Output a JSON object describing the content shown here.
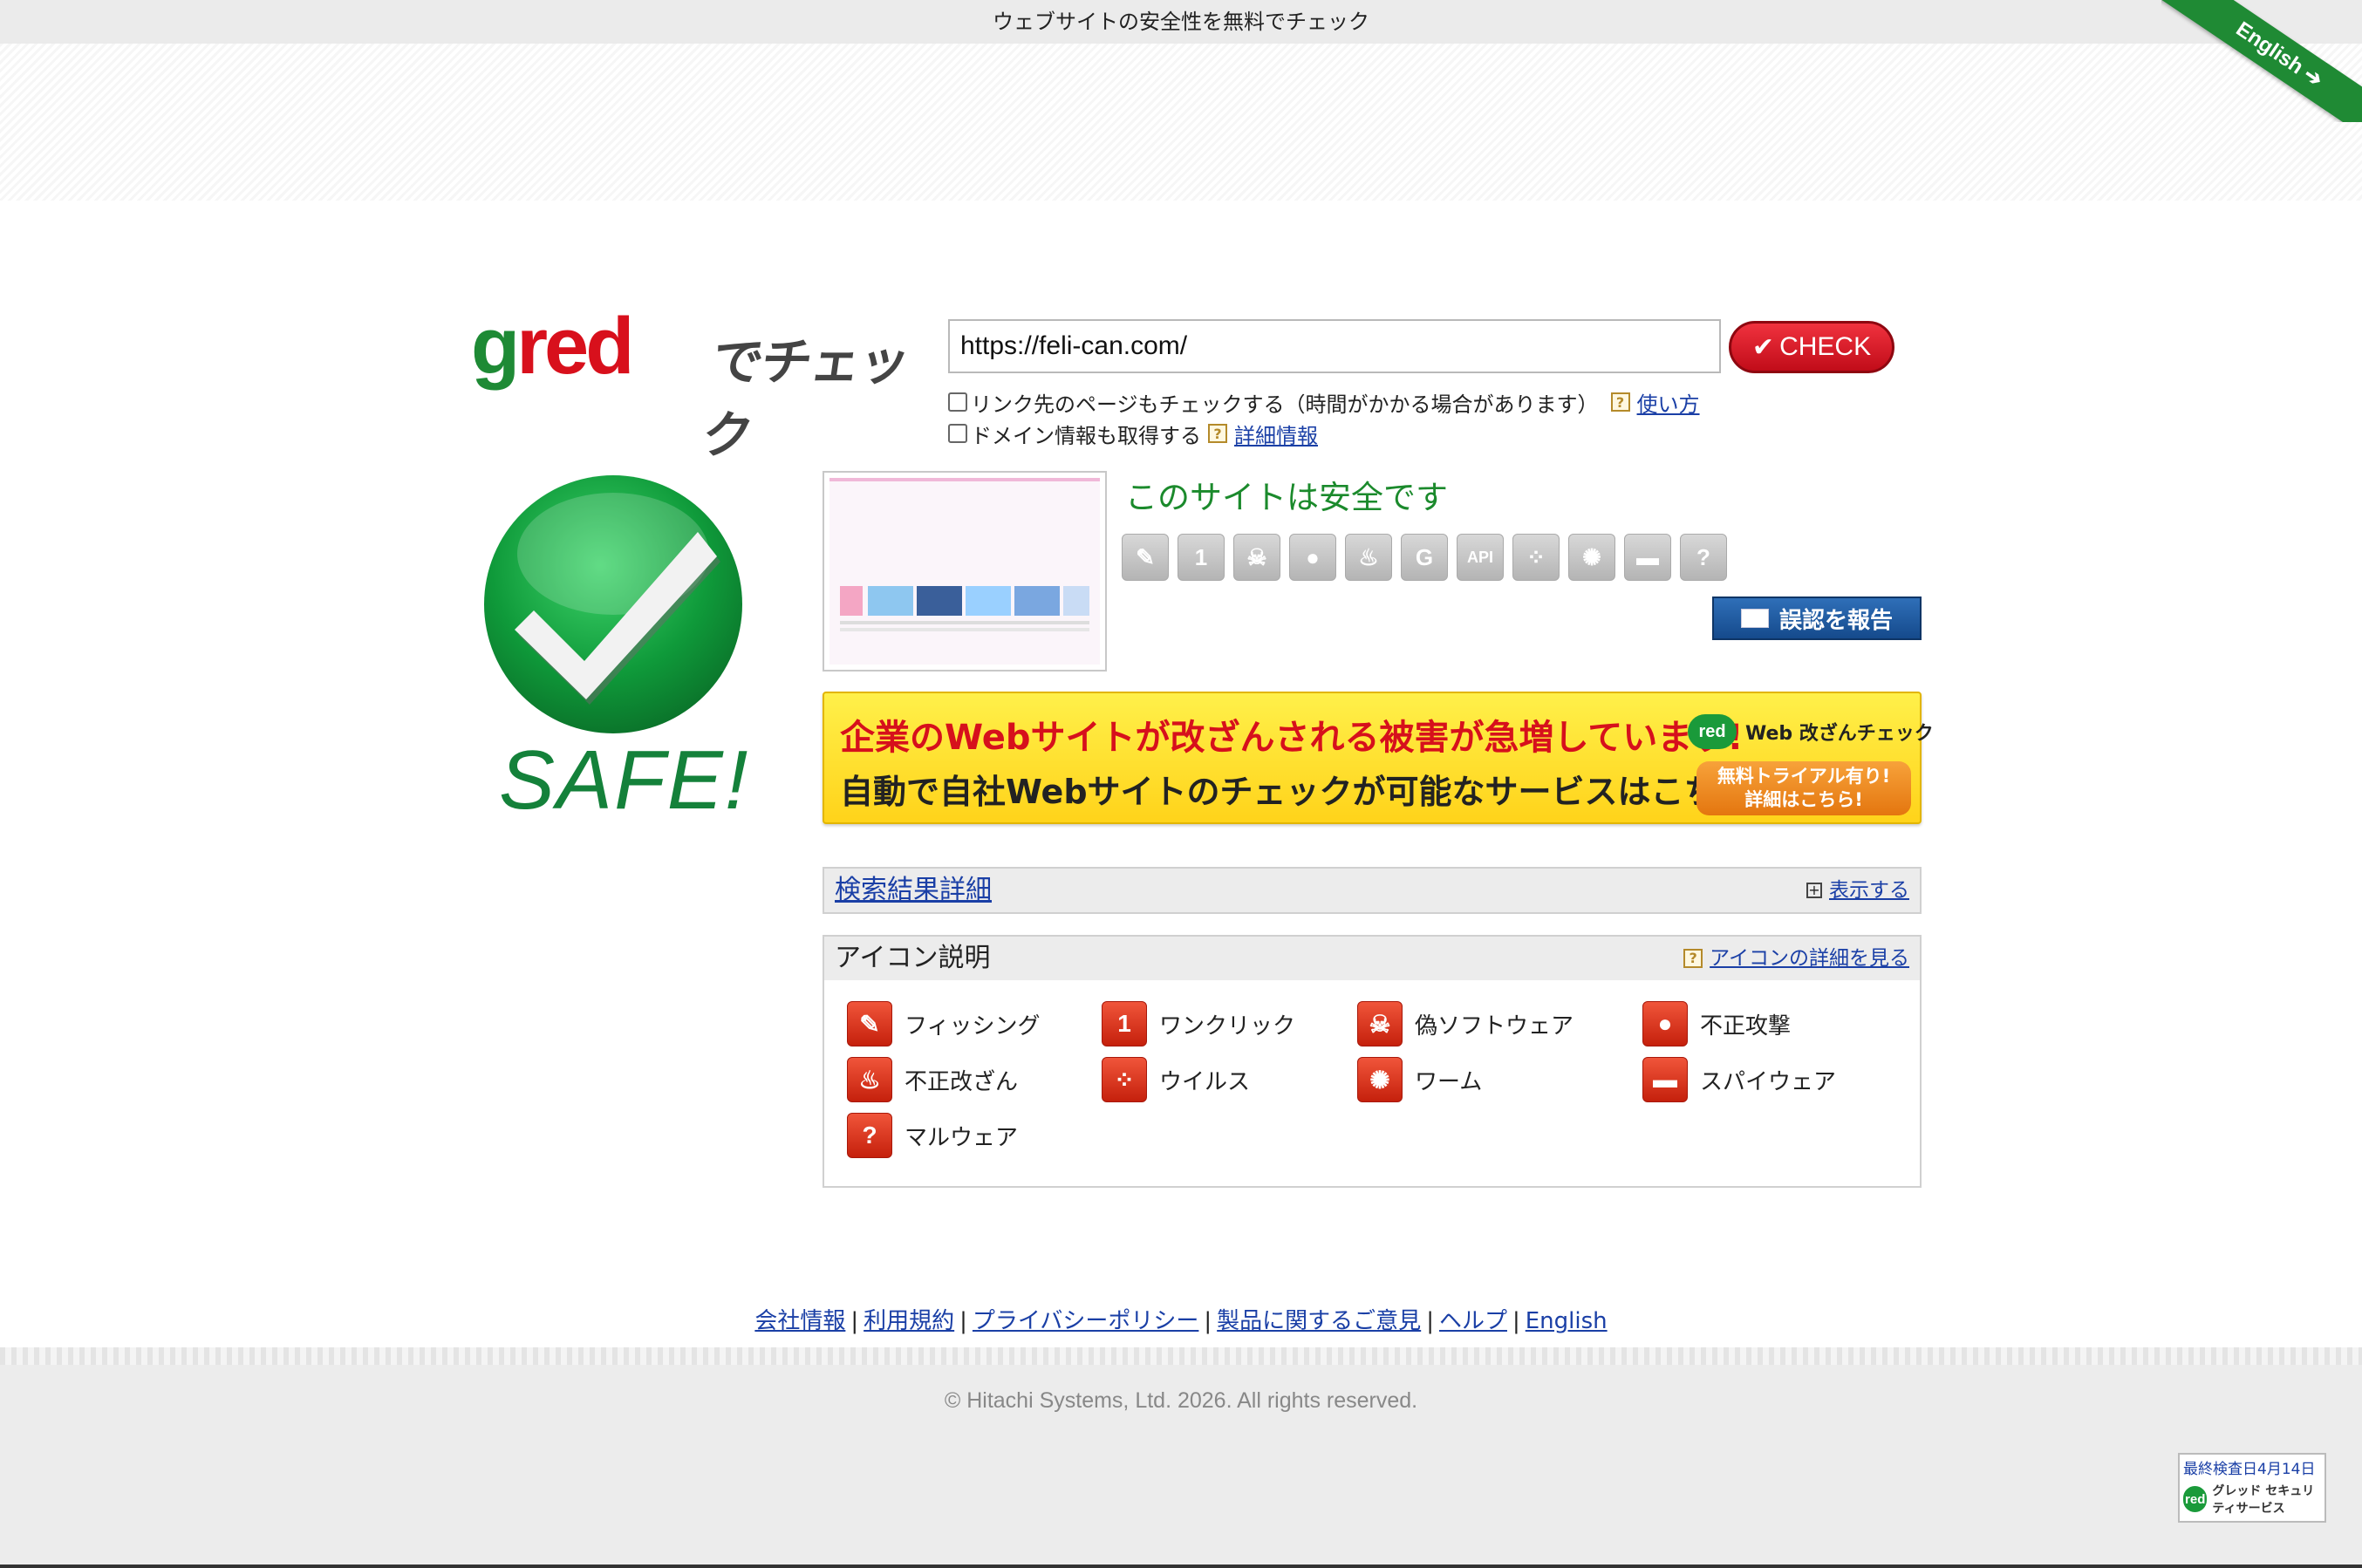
{
  "header": {
    "tagline": "ウェブサイトの安全性を無料でチェック",
    "english_ribbon": "English ➔"
  },
  "logo": {
    "letters": [
      "g",
      "r",
      "e",
      "d"
    ],
    "suffix": "でチェック"
  },
  "search": {
    "url_value": "https://feli-can.com/",
    "check_label": "CHECK"
  },
  "options": [
    {
      "label": "リンク先のページもチェックする（時間がかかる場合があります）",
      "link": "使い方",
      "checked": false
    },
    {
      "label": "ドメイン情報も取得する",
      "link": "詳細情報",
      "checked": false
    }
  ],
  "result": {
    "badge_text": "SAFE!",
    "title": "このサイトは安全です",
    "threat_icons": [
      "phishing-icon",
      "one-click-icon",
      "skull-icon",
      "bomb-icon",
      "fire-icon",
      "gred-g-icon",
      "api-icon",
      "virus-icon",
      "worm-icon",
      "spyware-gun-icon",
      "malware-question-icon"
    ],
    "threat_icon_glyphs": [
      "✎",
      "1",
      "☠",
      "●",
      "♨",
      "G",
      "API",
      "⁘",
      "✺",
      "▬",
      "?"
    ],
    "report_label": "誤認を報告"
  },
  "banner": {
    "line1": "企業のWebサイトが改ざんされる被害が急増しています!",
    "line2": "自動で自社Webサイトのチェックが可能なサービスはこちら!",
    "brand_logo": "red",
    "brand": "Web 改ざんチェック",
    "trial_line1": "無料トライアル有り!",
    "trial_line2": "詳細はこちら!"
  },
  "details_panel": {
    "title": "検索結果詳細",
    "toggle_label": "表示する"
  },
  "legend_panel": {
    "title": "アイコン説明",
    "detail_link": "アイコンの詳細を見る",
    "items": [
      {
        "label": "フィッシング",
        "icon": "phishing-icon",
        "glyph": "✎"
      },
      {
        "label": "ワンクリック",
        "icon": "one-click-icon",
        "glyph": "1"
      },
      {
        "label": "偽ソフトウェア",
        "icon": "skull-icon",
        "glyph": "☠"
      },
      {
        "label": "不正攻撃",
        "icon": "bomb-icon",
        "glyph": "●"
      },
      {
        "label": "不正改ざん",
        "icon": "fire-icon",
        "glyph": "♨"
      },
      {
        "label": "ウイルス",
        "icon": "virus-icon",
        "glyph": "⁘"
      },
      {
        "label": "ワーム",
        "icon": "worm-icon",
        "glyph": "✺"
      },
      {
        "label": "スパイウェア",
        "icon": "spyware-gun-icon",
        "glyph": "▬"
      },
      {
        "label": "マルウェア",
        "icon": "malware-question-icon",
        "glyph": "?"
      }
    ]
  },
  "footer": {
    "links": [
      "会社情報",
      "利用規約",
      "プライバシーポリシー",
      "製品に関するご意見",
      "ヘルプ",
      "English"
    ],
    "copyright": "© Hitachi Systems, Ltd. 2026. All rights reserved.",
    "seal_top": "最終検査日4月14日",
    "seal_logo": "red",
    "seal_brand": "グレッド セキュリティサービス"
  },
  "colors": {
    "safe_green": "#14813a",
    "title_green": "#1b8a2c",
    "check_red": "#d8101c",
    "link_blue": "#1a3fa6"
  }
}
